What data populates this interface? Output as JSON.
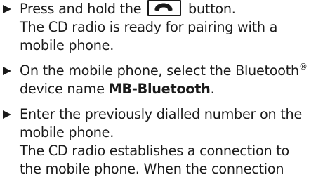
{
  "steps": [
    {
      "text_before_key": "Press and hold the",
      "key_icon": "phone-handset-icon",
      "text_after_key": "button.",
      "result_lines": [
        "The CD radio is ready for pairing with a",
        "mobile phone."
      ]
    },
    {
      "line1_text": "On the mobile phone, select the Bluetooth",
      "line1_superscript": "®",
      "line2_prefix": "device name ",
      "line2_bold": "MB-Bluetooth",
      "line2_suffix": "."
    },
    {
      "lines": [
        "Enter the previously dialled number on the",
        "mobile phone.",
        "The CD radio establishes a connection to",
        "the mobile phone. When the connection"
      ]
    }
  ]
}
